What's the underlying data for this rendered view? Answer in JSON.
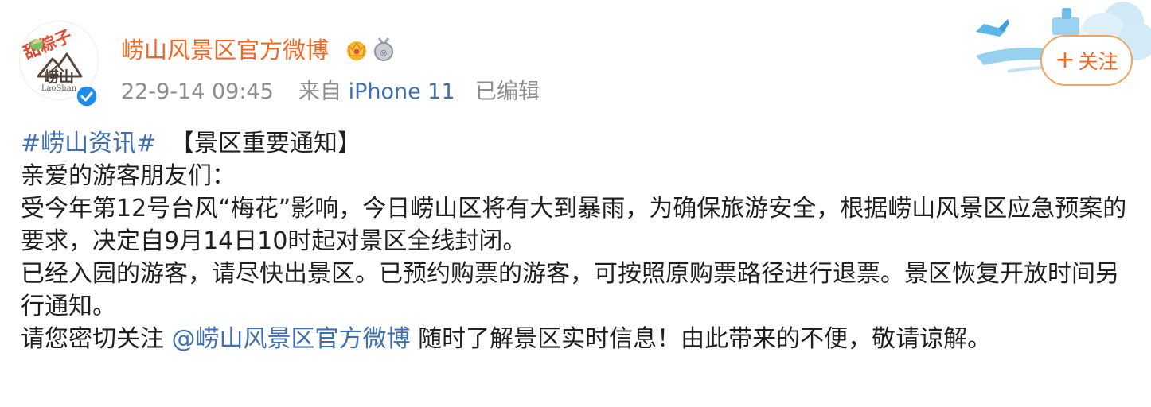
{
  "avatar": {
    "deco_text": "甜粽子",
    "brand_text": "崂山",
    "brand_sub": "LaoShan",
    "verified_icon": "verified-check-icon",
    "colors": {
      "verified": "#1e8bf0"
    }
  },
  "header": {
    "username": "崂山风景区官方微博",
    "badges": [
      "crown-member-icon",
      "medal-icon"
    ],
    "time": "22-9-14 09:45",
    "source_prefix": "来自",
    "device": "iPhone 11",
    "edited": "已编辑",
    "follow_label": "关注",
    "follow_icon": "plus-icon"
  },
  "post": {
    "hashtag": "#崂山资讯#",
    "notice_title": "【景区重要通知】",
    "greeting": "亲爱的游客朋友们：",
    "paragraph1": "受今年第12号台风“梅花”影响，今日崂山区将有大到暴雨，为确保旅游安全，根据崂山风景区应急预案的要求，决定自9月14日10时起对景区全线封闭。",
    "paragraph2": "已经入园的游客，请尽快出景区。已预约购票的游客，可按照原购票路径进行退票。景区恢复开放时间另行通知。",
    "closing_before": "请您密切关注",
    "mention": "@崂山风景区官方微博",
    "closing_after": "随时了解景区实时信息！由此带来的不便，敬请谅解。"
  },
  "colors": {
    "username": "#f26722",
    "link": "#3e6fb3",
    "meta": "#8c8c8c",
    "follow_border": "#f6a35a"
  }
}
